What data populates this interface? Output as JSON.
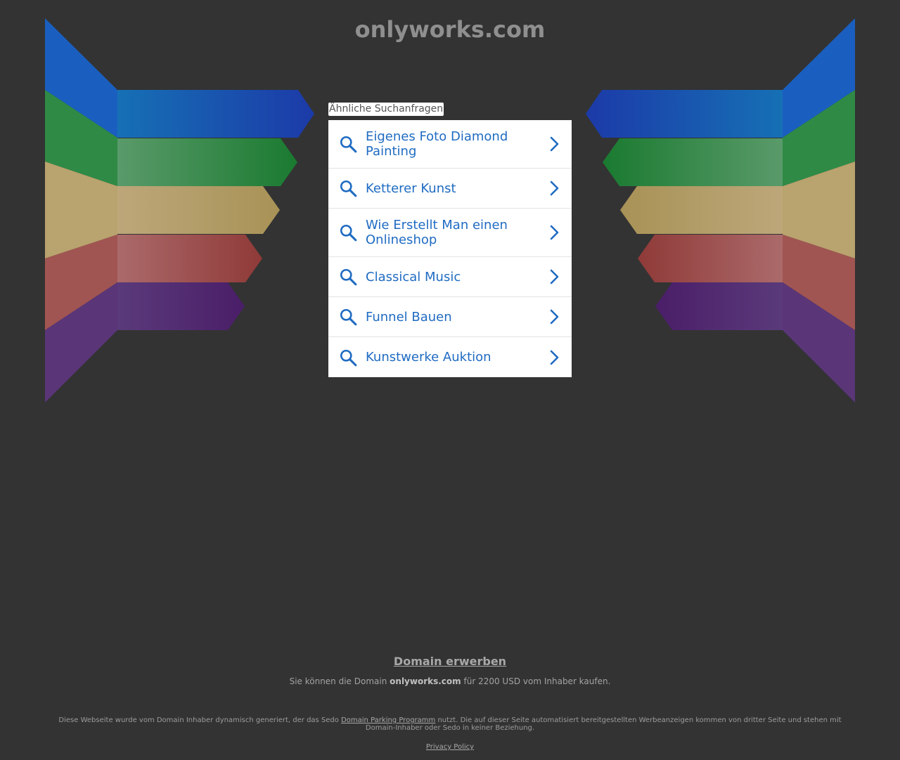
{
  "site": {
    "domain": "onlyworks.com"
  },
  "related": {
    "label": "Ähnliche Suchanfragen",
    "items": [
      {
        "label": "Eigenes Foto Diamond Painting",
        "icon": "search-icon",
        "chevron": "chevron-right-icon"
      },
      {
        "label": "Ketterer Kunst",
        "icon": "search-icon",
        "chevron": "chevron-right-icon"
      },
      {
        "label": "Wie Erstellt Man einen Onlineshop",
        "icon": "search-icon",
        "chevron": "chevron-right-icon"
      },
      {
        "label": "Classical Music",
        "icon": "search-icon",
        "chevron": "chevron-right-icon"
      },
      {
        "label": "Funnel Bauen",
        "icon": "search-icon",
        "chevron": "chevron-right-icon"
      },
      {
        "label": "Kunstwerke Auktion",
        "icon": "search-icon",
        "chevron": "chevron-right-icon"
      }
    ]
  },
  "footer": {
    "buy_link": "Domain erwerben",
    "buy_text_before": "Sie können die Domain",
    "buy_domain": "onlyworks.com",
    "buy_text_after": "für 2200 USD vom Inhaber kaufen.",
    "disclaimer_before": "Diese Webseite wurde vom Domain Inhaber dynamisch generiert, der das Sedo",
    "disclaimer_link": "Domain Parking Programm",
    "disclaimer_after": "nutzt. Die auf dieser Seite automatisiert bereitgestellten Werbeanzeigen kommen von dritter Seite und stehen mit Domain-Inhaber oder Sedo in keiner Beziehung.",
    "privacy": "Privacy Policy"
  },
  "colors": {
    "background": "#333333",
    "link_blue": "#1f6bc2",
    "band_blue": "#1a3fb0",
    "band_green": "#1e7a34",
    "band_tan": "#b09a62",
    "band_red": "#9a4040",
    "band_purple": "#4a2470"
  }
}
